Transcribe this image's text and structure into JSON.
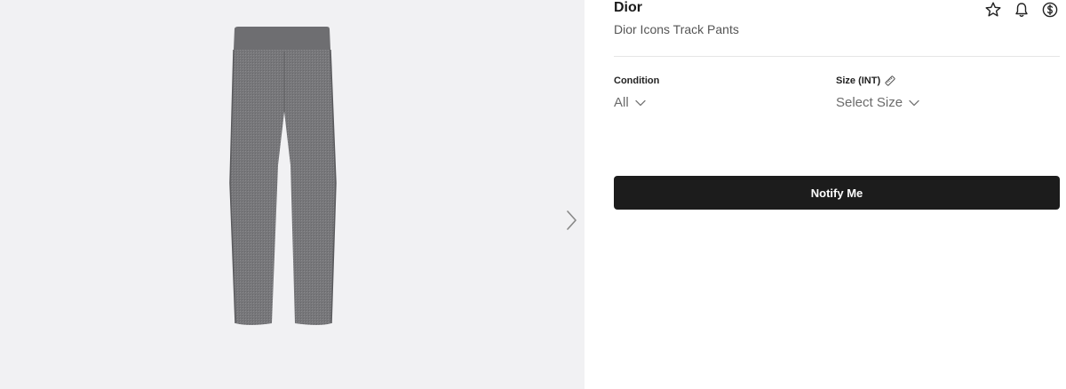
{
  "product": {
    "brand": "Dior",
    "name": "Dior Icons Track Pants"
  },
  "actions": {
    "icons": [
      "star-icon",
      "bell-icon",
      "dollar-icon"
    ]
  },
  "filters": {
    "condition": {
      "label": "Condition",
      "value": "All"
    },
    "size": {
      "label": "Size (INT)",
      "value": "Select Size"
    }
  },
  "notify_button": {
    "label": "Notify Me"
  },
  "colors": {
    "button_bg": "#1c1c1c",
    "gallery_bg": "#f1f1f3",
    "pants": "#7a7a7c"
  }
}
